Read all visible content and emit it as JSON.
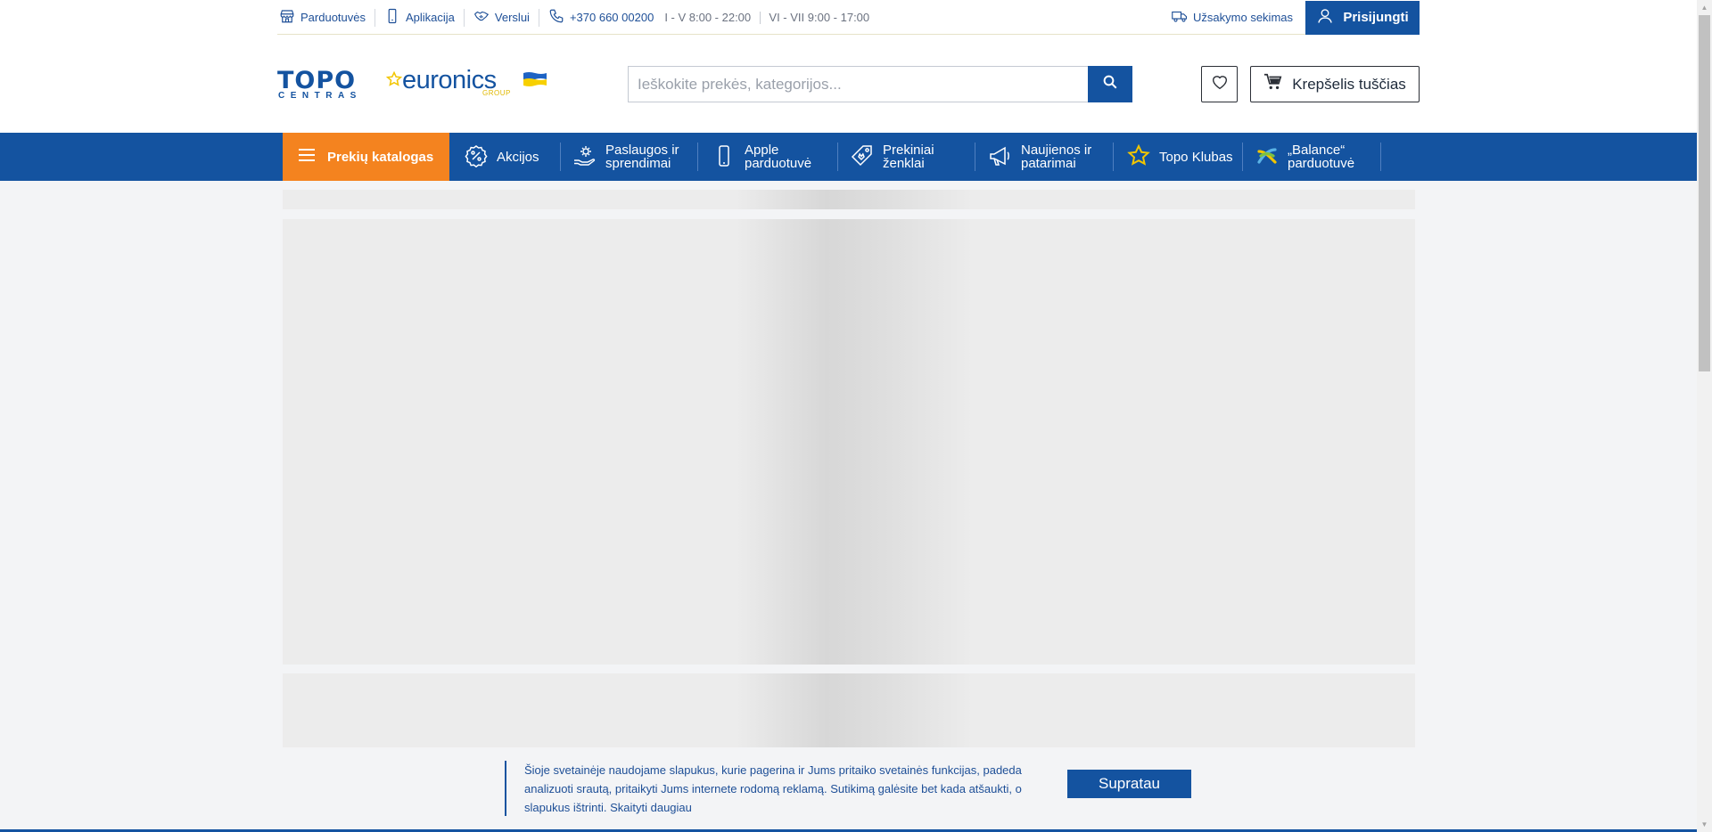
{
  "topbar": {
    "links": [
      {
        "label": "Parduotuvės",
        "icon": "store-icon"
      },
      {
        "label": "Aplikacija",
        "icon": "phone-icon"
      },
      {
        "label": "Verslui",
        "icon": "handshake-icon"
      }
    ],
    "phone": "+370 660 00200",
    "hours_weekdays": "I - V 8:00 - 22:00",
    "hours_weekend": "VI - VII 9:00 - 17:00",
    "order_tracking": "Užsakymo sekimas",
    "login": "Prisijungti"
  },
  "logo": {
    "topo": "TOPO",
    "centras": "CENTRAS",
    "euronics": "euronics",
    "group": "GROUP"
  },
  "search": {
    "placeholder": "Ieškokite prekės, kategorijos..."
  },
  "cart": {
    "label": "Krepšelis tuščias"
  },
  "nav": {
    "catalog": "Prekių katalogas",
    "items": [
      {
        "line1": "Akcijos",
        "line2": "",
        "icon": "percent-badge-icon"
      },
      {
        "line1": "Paslaugos ir",
        "line2": "sprendimai",
        "icon": "services-hand-icon"
      },
      {
        "line1": "Apple",
        "line2": "parduotuvė",
        "icon": "smartphone-icon"
      },
      {
        "line1": "Prekiniai",
        "line2": "ženklai",
        "icon": "tag-icon"
      },
      {
        "line1": "Naujienos ir",
        "line2": "patarimai",
        "icon": "megaphone-icon"
      },
      {
        "line1": "Topo Klubas",
        "line2": "",
        "icon": "star-icon"
      },
      {
        "line1": "„Balance“",
        "line2": "parduotuvė",
        "icon": "balance-logo-icon"
      }
    ]
  },
  "cookie": {
    "text": "Šioje svetainėje naudojame slapukus, kurie pagerina ir Jums pritaiko svetainės funkcijas, padeda analizuoti srautą, pritaikyti Jums internete rodomą reklamą. Sutikimą galėsite bet kada atšaukti, o slapukus ištrinti.",
    "link": "Skaityti daugiau",
    "button": "Supratau"
  },
  "colors": {
    "brand_blue": "#1453a0",
    "catalog_orange": "#f4831f",
    "accent_yellow": "#f2c500"
  }
}
